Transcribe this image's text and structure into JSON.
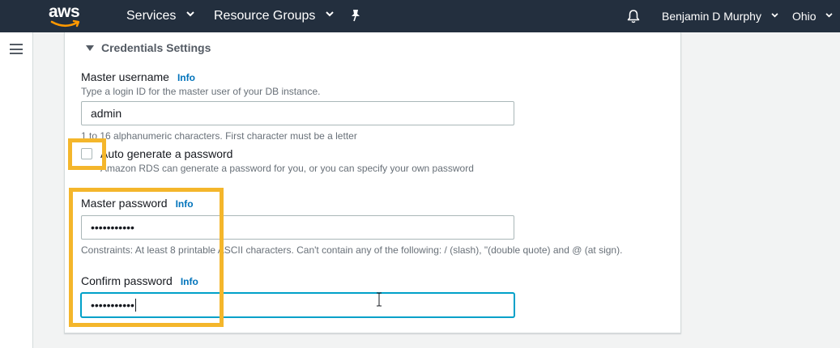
{
  "nav": {
    "logo_text": "aws",
    "services_label": "Services",
    "resource_groups_label": "Resource Groups",
    "user_label": "Benjamin D Murphy",
    "region_label": "Ohio"
  },
  "section": {
    "title": "Credentials Settings"
  },
  "master_username": {
    "label": "Master username",
    "info": "Info",
    "description": "Type a login ID for the master user of your DB instance.",
    "value": "admin",
    "hint": "1 to 16 alphanumeric characters. First character must be a letter"
  },
  "auto_generate": {
    "label": "Auto generate a password",
    "description": "Amazon RDS can generate a password for you, or you can specify your own password",
    "checked": false
  },
  "master_password": {
    "label": "Master password",
    "info": "Info",
    "value": "•••••••••••",
    "constraints": "Constraints: At least 8 printable ASCII characters. Can't contain any of the following: / (slash), \"(double quote) and @ (at sign)."
  },
  "confirm_password": {
    "label": "Confirm password",
    "info": "Info",
    "value": "•••••••••••"
  },
  "colors": {
    "nav_bg": "#232f3e",
    "link": "#0073bb",
    "highlight": "#f4b62b",
    "focus": "#00a1c9"
  }
}
